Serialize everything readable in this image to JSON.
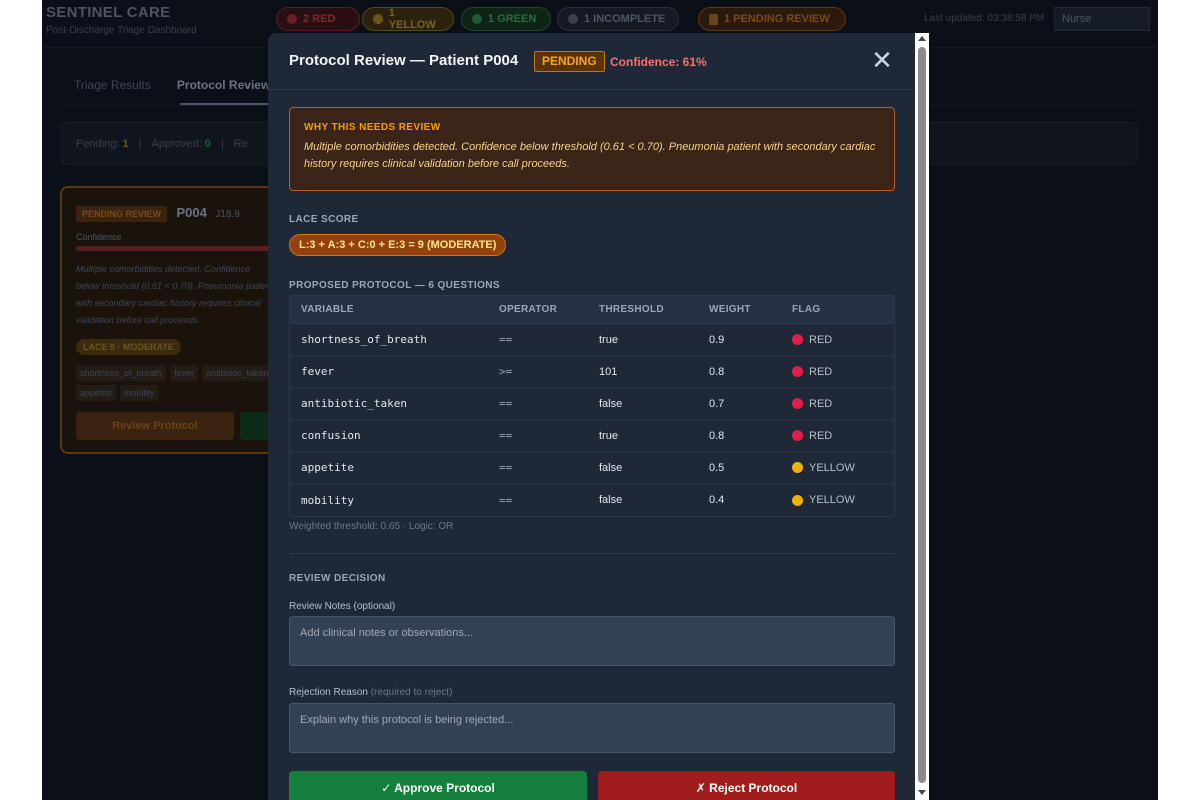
{
  "app": {
    "title": "SENTINEL CARE",
    "subtitle": "Post-Discharge Triage Dashboard",
    "last_updated": "Last updated: 03:38:58 PM",
    "role": "Nurse"
  },
  "status_pills": {
    "red": "2 RED",
    "yellow": "1 YELLOW",
    "green": "1 GREEN",
    "incomplete": "1 INCOMPLETE",
    "pending": "1 PENDING REVIEW"
  },
  "tabs": {
    "triage": "Triage Results",
    "protocol": "Protocol Review"
  },
  "stats": {
    "pending_label": "Pending:",
    "pending_value": "1",
    "approved_label": "Approved:",
    "approved_value": "0",
    "sep": "|",
    "rejected_partial": "Re"
  },
  "card": {
    "badge": "PENDING REVIEW",
    "patient_id": "P004",
    "code": "J18.9",
    "confidence_label": "Confidence",
    "text": "Multiple comorbidities detected. Confidence below threshold (0.61 < 0.70). Pneumonia patient with secondary cardiac history requires clinical validation before call proceeds.",
    "lace": "LACE 9 · MODERATE",
    "tags": [
      "shortness_of_breath",
      "fever",
      "antibiotic_taken",
      "appetite",
      "mobility"
    ],
    "review_button": "Review Protocol"
  },
  "modal": {
    "title": "Protocol Review — Patient P004",
    "status": "PENDING",
    "confidence": "Confidence: 61%",
    "close_symbol": "✕",
    "why_title": "WHY THIS NEEDS REVIEW",
    "why_text": "Multiple comorbidities detected. Confidence below threshold (0.61 < 0.70). Pneumonia patient with secondary cardiac history requires clinical validation before call proceeds.",
    "lace_label": "LACE SCORE",
    "lace_value": "L:3 + A:3 + C:0 + E:3 = 9 (MODERATE)",
    "protocol_label": "PROPOSED PROTOCOL — 6 QUESTIONS",
    "table": {
      "headers": [
        "VARIABLE",
        "OPERATOR",
        "THRESHOLD",
        "WEIGHT",
        "FLAG"
      ],
      "rows": [
        {
          "variable": "shortness_of_breath",
          "operator": "==",
          "threshold": "true",
          "weight": "0.9",
          "flag": "RED",
          "flag_color": "#e11d48"
        },
        {
          "variable": "fever",
          "operator": ">=",
          "threshold": "101",
          "weight": "0.8",
          "flag": "RED",
          "flag_color": "#e11d48"
        },
        {
          "variable": "antibiotic_taken",
          "operator": "==",
          "threshold": "false",
          "weight": "0.7",
          "flag": "RED",
          "flag_color": "#e11d48"
        },
        {
          "variable": "confusion",
          "operator": "==",
          "threshold": "true",
          "weight": "0.8",
          "flag": "RED",
          "flag_color": "#e11d48"
        },
        {
          "variable": "appetite",
          "operator": "==",
          "threshold": "false",
          "weight": "0.5",
          "flag": "YELLOW",
          "flag_color": "#eab308"
        },
        {
          "variable": "mobility",
          "operator": "==",
          "threshold": "false",
          "weight": "0.4",
          "flag": "YELLOW",
          "flag_color": "#eab308"
        }
      ]
    },
    "threshold_note": "Weighted threshold: 0.65 · Logic: OR",
    "decision_label": "REVIEW DECISION",
    "notes_label": "Review Notes",
    "notes_optional": "(optional)",
    "notes_placeholder": "Add clinical notes or observations...",
    "reject_label": "Rejection Reason",
    "reject_required": "(required to reject)",
    "reject_placeholder": "Explain why this protocol is being rejected...",
    "approve_button": "✓ Approve Protocol",
    "reject_button": "✗ Reject Protocol"
  },
  "colors": {
    "modal_bg": "#1e2836",
    "pending_accent": "#f5a524",
    "red_flag": "#e11d48",
    "yellow_flag": "#eab308",
    "approve": "#15803d",
    "reject": "#a11d1d"
  }
}
